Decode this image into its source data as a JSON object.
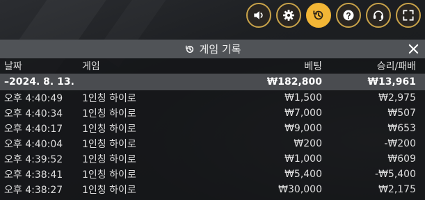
{
  "toolbar": {
    "buttons": [
      {
        "name": "sound-button",
        "icon": "speaker-icon",
        "active": false
      },
      {
        "name": "settings-button",
        "icon": "gear-icon",
        "active": false
      },
      {
        "name": "history-button",
        "icon": "history-icon",
        "active": true
      },
      {
        "name": "help-button",
        "icon": "question-icon",
        "active": false
      },
      {
        "name": "support-button",
        "icon": "headset-icon",
        "active": false
      },
      {
        "name": "fullscreen-button",
        "icon": "fullscreen-icon",
        "active": false
      }
    ],
    "accent_color": "#f2b636"
  },
  "panel": {
    "title": "게임 기록",
    "columns": {
      "date": "날짜",
      "game": "게임",
      "bet": "베팅",
      "result": "승리/패배"
    },
    "summary": {
      "date": "–2024. 8. 13.",
      "bet": "₩182,800",
      "result": "₩13,961"
    },
    "rows": [
      {
        "time": "오후 4:40:49",
        "game": "1인칭 하이로",
        "bet": "₩1,500",
        "result": "₩2,975"
      },
      {
        "time": "오후 4:40:34",
        "game": "1인칭 하이로",
        "bet": "₩7,000",
        "result": "₩507"
      },
      {
        "time": "오후 4:40:17",
        "game": "1인칭 하이로",
        "bet": "₩9,000",
        "result": "₩653"
      },
      {
        "time": "오후 4:40:04",
        "game": "1인칭 하이로",
        "bet": "₩200",
        "result": "-₩200"
      },
      {
        "time": "오후 4:39:52",
        "game": "1인칭 하이로",
        "bet": "₩1,000",
        "result": "₩609"
      },
      {
        "time": "오후 4:38:41",
        "game": "1인칭 하이로",
        "bet": "₩5,400",
        "result": "-₩5,400"
      },
      {
        "time": "오후 4:38:27",
        "game": "1인칭 하이로",
        "bet": "₩30,000",
        "result": "₩2,175"
      }
    ]
  }
}
